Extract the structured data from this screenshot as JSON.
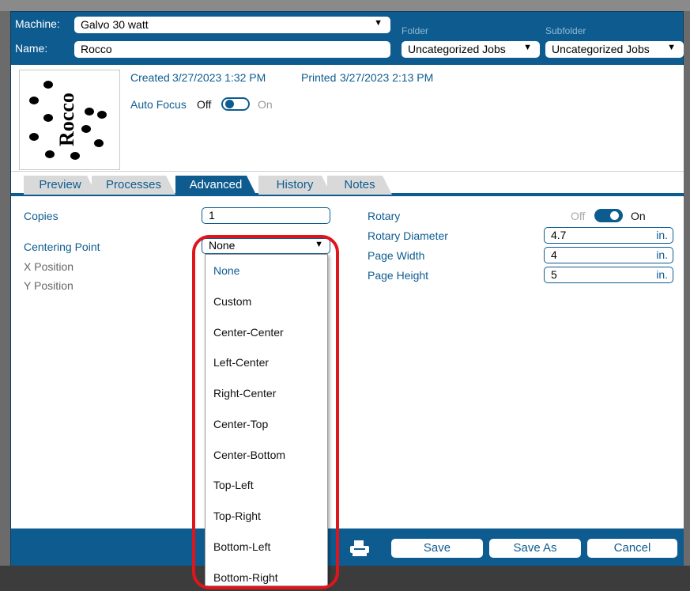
{
  "header": {
    "machine_label": "Machine:",
    "machine_value": "Galvo 30 watt",
    "name_label": "Name:",
    "name_value": "Rocco",
    "folder_label": "Folder",
    "folder_value": "Uncategorized Jobs",
    "subfolder_label": "Subfolder",
    "subfolder_value": "Uncategorized Jobs"
  },
  "info": {
    "created_label": "Created",
    "created_value": "3/27/2023 1:32 PM",
    "printed_label": "Printed",
    "printed_value": "3/27/2023 2:13 PM",
    "autofocus_label": "Auto Focus",
    "autofocus_off": "Off",
    "autofocus_on": "On",
    "thumbnail_text": "Rocco"
  },
  "tabs": [
    {
      "label": "Preview",
      "active": false
    },
    {
      "label": "Processes",
      "active": false
    },
    {
      "label": "Advanced",
      "active": true
    },
    {
      "label": "History",
      "active": false
    },
    {
      "label": "Notes",
      "active": false
    }
  ],
  "advanced": {
    "copies_label": "Copies",
    "copies_value": "1",
    "centering_label": "Centering Point",
    "centering_value": "None",
    "xpos_label": "X Position",
    "ypos_label": "Y Position",
    "rotary_label": "Rotary",
    "rotary_off": "Off",
    "rotary_on": "On",
    "rotary_diameter_label": "Rotary Diameter",
    "rotary_diameter_value": "4.7",
    "page_width_label": "Page Width",
    "page_width_value": "4",
    "page_height_label": "Page Height",
    "page_height_value": "5",
    "unit": "in."
  },
  "dropdown": {
    "options": [
      "None",
      "Custom",
      "Center-Center",
      "Left-Center",
      "Right-Center",
      "Center-Top",
      "Center-Bottom",
      "Top-Left",
      "Top-Right",
      "Bottom-Left",
      "Bottom-Right"
    ],
    "selected": "None"
  },
  "footer": {
    "save_label": "Save",
    "save_as_label": "Save As",
    "cancel_label": "Cancel"
  },
  "colors": {
    "primary": "#0e5c8f",
    "highlight_ring": "#e0151c"
  }
}
